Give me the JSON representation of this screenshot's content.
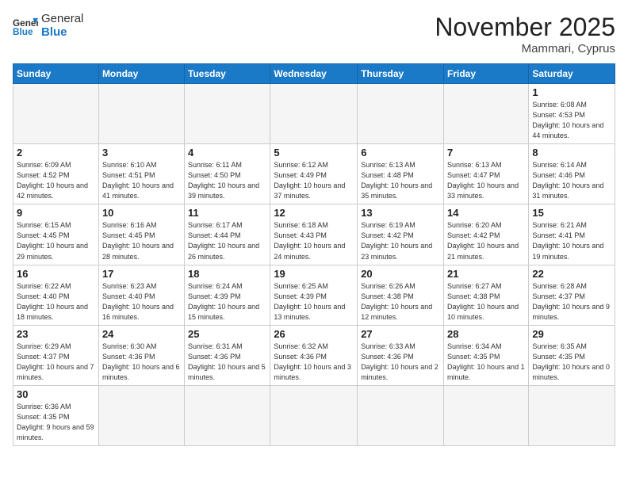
{
  "header": {
    "logo_general": "General",
    "logo_blue": "Blue",
    "month_title": "November 2025",
    "location": "Mammari, Cyprus"
  },
  "weekdays": [
    "Sunday",
    "Monday",
    "Tuesday",
    "Wednesday",
    "Thursday",
    "Friday",
    "Saturday"
  ],
  "weeks": [
    [
      {
        "day": "",
        "info": ""
      },
      {
        "day": "",
        "info": ""
      },
      {
        "day": "",
        "info": ""
      },
      {
        "day": "",
        "info": ""
      },
      {
        "day": "",
        "info": ""
      },
      {
        "day": "",
        "info": ""
      },
      {
        "day": "1",
        "info": "Sunrise: 6:08 AM\nSunset: 4:53 PM\nDaylight: 10 hours and 44 minutes."
      }
    ],
    [
      {
        "day": "2",
        "info": "Sunrise: 6:09 AM\nSunset: 4:52 PM\nDaylight: 10 hours and 42 minutes."
      },
      {
        "day": "3",
        "info": "Sunrise: 6:10 AM\nSunset: 4:51 PM\nDaylight: 10 hours and 41 minutes."
      },
      {
        "day": "4",
        "info": "Sunrise: 6:11 AM\nSunset: 4:50 PM\nDaylight: 10 hours and 39 minutes."
      },
      {
        "day": "5",
        "info": "Sunrise: 6:12 AM\nSunset: 4:49 PM\nDaylight: 10 hours and 37 minutes."
      },
      {
        "day": "6",
        "info": "Sunrise: 6:13 AM\nSunset: 4:48 PM\nDaylight: 10 hours and 35 minutes."
      },
      {
        "day": "7",
        "info": "Sunrise: 6:13 AM\nSunset: 4:47 PM\nDaylight: 10 hours and 33 minutes."
      },
      {
        "day": "8",
        "info": "Sunrise: 6:14 AM\nSunset: 4:46 PM\nDaylight: 10 hours and 31 minutes."
      }
    ],
    [
      {
        "day": "9",
        "info": "Sunrise: 6:15 AM\nSunset: 4:45 PM\nDaylight: 10 hours and 29 minutes."
      },
      {
        "day": "10",
        "info": "Sunrise: 6:16 AM\nSunset: 4:45 PM\nDaylight: 10 hours and 28 minutes."
      },
      {
        "day": "11",
        "info": "Sunrise: 6:17 AM\nSunset: 4:44 PM\nDaylight: 10 hours and 26 minutes."
      },
      {
        "day": "12",
        "info": "Sunrise: 6:18 AM\nSunset: 4:43 PM\nDaylight: 10 hours and 24 minutes."
      },
      {
        "day": "13",
        "info": "Sunrise: 6:19 AM\nSunset: 4:42 PM\nDaylight: 10 hours and 23 minutes."
      },
      {
        "day": "14",
        "info": "Sunrise: 6:20 AM\nSunset: 4:42 PM\nDaylight: 10 hours and 21 minutes."
      },
      {
        "day": "15",
        "info": "Sunrise: 6:21 AM\nSunset: 4:41 PM\nDaylight: 10 hours and 19 minutes."
      }
    ],
    [
      {
        "day": "16",
        "info": "Sunrise: 6:22 AM\nSunset: 4:40 PM\nDaylight: 10 hours and 18 minutes."
      },
      {
        "day": "17",
        "info": "Sunrise: 6:23 AM\nSunset: 4:40 PM\nDaylight: 10 hours and 16 minutes."
      },
      {
        "day": "18",
        "info": "Sunrise: 6:24 AM\nSunset: 4:39 PM\nDaylight: 10 hours and 15 minutes."
      },
      {
        "day": "19",
        "info": "Sunrise: 6:25 AM\nSunset: 4:39 PM\nDaylight: 10 hours and 13 minutes."
      },
      {
        "day": "20",
        "info": "Sunrise: 6:26 AM\nSunset: 4:38 PM\nDaylight: 10 hours and 12 minutes."
      },
      {
        "day": "21",
        "info": "Sunrise: 6:27 AM\nSunset: 4:38 PM\nDaylight: 10 hours and 10 minutes."
      },
      {
        "day": "22",
        "info": "Sunrise: 6:28 AM\nSunset: 4:37 PM\nDaylight: 10 hours and 9 minutes."
      }
    ],
    [
      {
        "day": "23",
        "info": "Sunrise: 6:29 AM\nSunset: 4:37 PM\nDaylight: 10 hours and 7 minutes."
      },
      {
        "day": "24",
        "info": "Sunrise: 6:30 AM\nSunset: 4:36 PM\nDaylight: 10 hours and 6 minutes."
      },
      {
        "day": "25",
        "info": "Sunrise: 6:31 AM\nSunset: 4:36 PM\nDaylight: 10 hours and 5 minutes."
      },
      {
        "day": "26",
        "info": "Sunrise: 6:32 AM\nSunset: 4:36 PM\nDaylight: 10 hours and 3 minutes."
      },
      {
        "day": "27",
        "info": "Sunrise: 6:33 AM\nSunset: 4:36 PM\nDaylight: 10 hours and 2 minutes."
      },
      {
        "day": "28",
        "info": "Sunrise: 6:34 AM\nSunset: 4:35 PM\nDaylight: 10 hours and 1 minute."
      },
      {
        "day": "29",
        "info": "Sunrise: 6:35 AM\nSunset: 4:35 PM\nDaylight: 10 hours and 0 minutes."
      }
    ],
    [
      {
        "day": "30",
        "info": "Sunrise: 6:36 AM\nSunset: 4:35 PM\nDaylight: 9 hours and 59 minutes."
      },
      {
        "day": "",
        "info": ""
      },
      {
        "day": "",
        "info": ""
      },
      {
        "day": "",
        "info": ""
      },
      {
        "day": "",
        "info": ""
      },
      {
        "day": "",
        "info": ""
      },
      {
        "day": "",
        "info": ""
      }
    ]
  ]
}
